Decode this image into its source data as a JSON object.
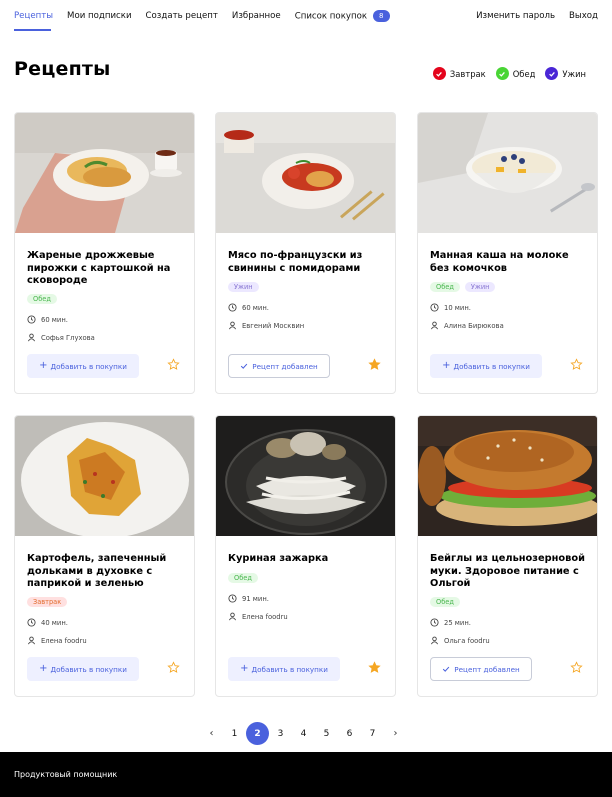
{
  "nav": {
    "items": [
      {
        "label": "Рецепты"
      },
      {
        "label": "Мои подписки"
      },
      {
        "label": "Создать рецепт"
      },
      {
        "label": "Избранное"
      },
      {
        "label": "Список покупок",
        "badge": "8"
      }
    ],
    "right": [
      {
        "label": "Изменить пароль"
      },
      {
        "label": "Выход"
      }
    ]
  },
  "page_title": "Рецепты",
  "filters": [
    {
      "label": "Завтрак",
      "color": "#e4041c"
    },
    {
      "label": "Обед",
      "color": "#49d535"
    },
    {
      "label": "Ужин",
      "color": "#4a26d6"
    }
  ],
  "cards": [
    {
      "title": "Жареные дрожжевые пирожки с картошкой на сковороде",
      "tags": [
        "Обед"
      ],
      "time": "60 мин.",
      "author": "Софья Глухова",
      "button": "Добавить в покупки",
      "favorite": false
    },
    {
      "title": "Мясо по-французски из свинины с помидорами",
      "tags": [
        "Ужин"
      ],
      "time": "60 мин.",
      "author": "Евгений Москвин",
      "button": "Рецепт добавлен",
      "favorite": true
    },
    {
      "title": "Манная каша на молоке без комочков",
      "tags": [
        "Обед",
        "Ужин"
      ],
      "time": "10 мин.",
      "author": "Алина Бирюкова",
      "button": "Добавить в покупки",
      "favorite": false
    },
    {
      "title": "Картофель, запеченный дольками в духовке с паприкой и зеленью",
      "tags": [
        "Завтрак"
      ],
      "time": "40 мин.",
      "author": "Елена foodru",
      "button": "Добавить в покупки",
      "favorite": false
    },
    {
      "title": "Куриная зажарка",
      "tags": [
        "Обед"
      ],
      "time": "91 мин.",
      "author": "Елена foodru",
      "button": "Добавить в покупки",
      "favorite": true
    },
    {
      "title": "Бейглы из цельнозерновой муки. Здоровое питание с Ольгой",
      "tags": [
        "Обед"
      ],
      "time": "25 мин.",
      "author": "Ольга foodru",
      "button": "Рецепт добавлен",
      "favorite": false
    }
  ],
  "pagination": {
    "prev": "‹",
    "pages": [
      "1",
      "2",
      "3",
      "4",
      "5",
      "6",
      "7"
    ],
    "current": "2",
    "next": "›"
  },
  "footer": {
    "brand": "Продуктовый помощник"
  },
  "colors": {
    "accent": "#4a61dd",
    "star": "#f5a623",
    "footer_bg": "#000000"
  }
}
